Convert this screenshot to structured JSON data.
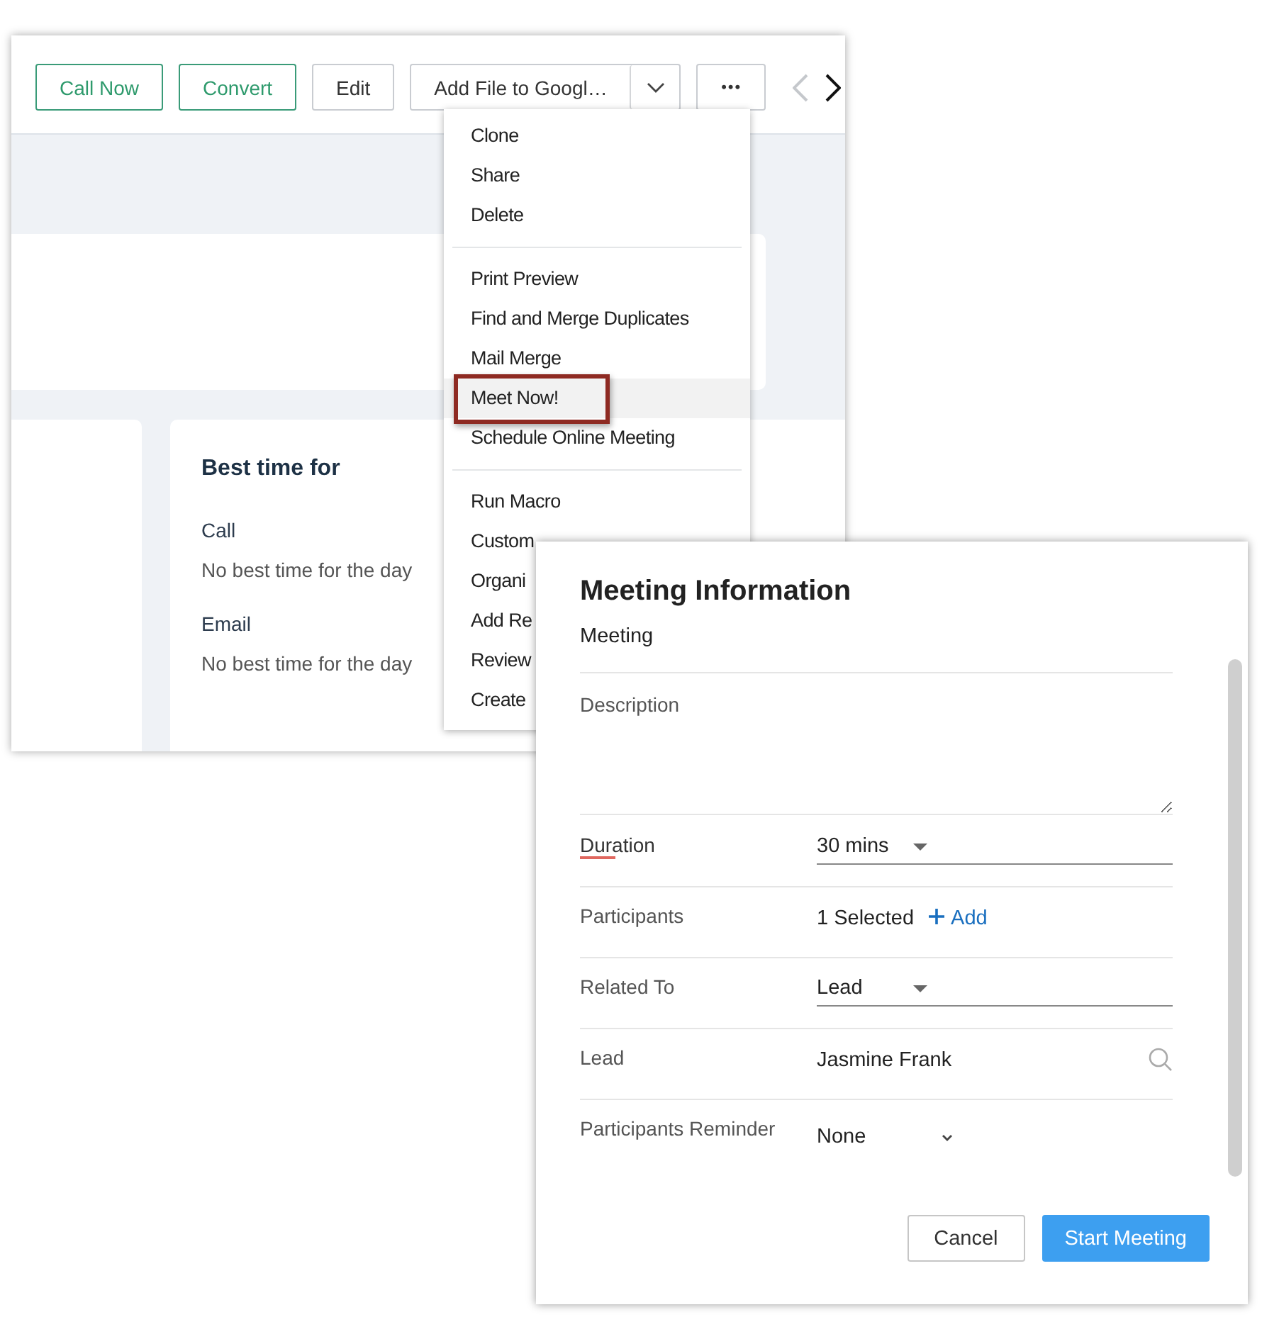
{
  "toolbar": {
    "buttons": [
      {
        "label": "Call Now",
        "kind": "outline"
      },
      {
        "label": "Convert",
        "kind": "outline"
      },
      {
        "label": "Edit",
        "kind": "plain"
      },
      {
        "label": "Add File to Googl…",
        "kind": "split"
      },
      {
        "label": "•••",
        "kind": "more"
      }
    ],
    "prev": {
      "disabled": true
    },
    "next": {
      "disabled": false
    }
  },
  "best_time": {
    "title": "Best time for",
    "entries": [
      {
        "label": "Call",
        "value": "No best time for the day"
      },
      {
        "label": "Email",
        "value": "No best time for the day"
      }
    ]
  },
  "menu": {
    "groups": [
      {
        "items": [
          {
            "label": "Clone",
            "selected": false,
            "outlined": false
          },
          {
            "label": "Share",
            "selected": false,
            "outlined": false
          },
          {
            "label": "Delete",
            "selected": false,
            "outlined": false
          }
        ]
      },
      {
        "items": [
          {
            "label": "Print Preview",
            "selected": false,
            "outlined": false
          },
          {
            "label": "Find and Merge Duplicates",
            "selected": false,
            "outlined": false
          },
          {
            "label": "Mail Merge",
            "selected": false,
            "outlined": false
          },
          {
            "label": "Meet Now!",
            "selected": true,
            "outlined": true
          },
          {
            "label": "Schedule Online Meeting",
            "selected": false,
            "outlined": false
          }
        ]
      },
      {
        "items": [
          {
            "label": "Run Macro",
            "selected": false,
            "outlined": false
          },
          {
            "label": "Custom",
            "selected": false,
            "outlined": false
          },
          {
            "label": "Organi",
            "selected": false,
            "outlined": false
          },
          {
            "label": "Add Re",
            "selected": false,
            "outlined": false
          },
          {
            "label": "Review",
            "selected": false,
            "outlined": false
          },
          {
            "label": "Create",
            "selected": false,
            "outlined": false
          }
        ]
      }
    ]
  },
  "dialog": {
    "title": "Meeting Information",
    "subject": "Meeting",
    "fields": [
      {
        "kind": "textarea",
        "label": "Description",
        "active": false
      },
      {
        "kind": "select",
        "label": "Duration",
        "value": "30 mins",
        "active": true
      },
      {
        "kind": "participants",
        "label": "Participants",
        "value": "1 Selected",
        "action": "Add",
        "active": false
      },
      {
        "kind": "select",
        "label": "Related To",
        "value": "Lead",
        "active": false
      },
      {
        "kind": "lookup",
        "label": "Lead",
        "value": "Jasmine Frank",
        "active": false
      },
      {
        "kind": "dropdown",
        "label": "Participants Reminder",
        "value": "None",
        "active": false
      }
    ],
    "buttons": [
      {
        "label": "Cancel",
        "kind": "secondary"
      },
      {
        "label": "Start Meeting",
        "kind": "primary"
      }
    ]
  }
}
